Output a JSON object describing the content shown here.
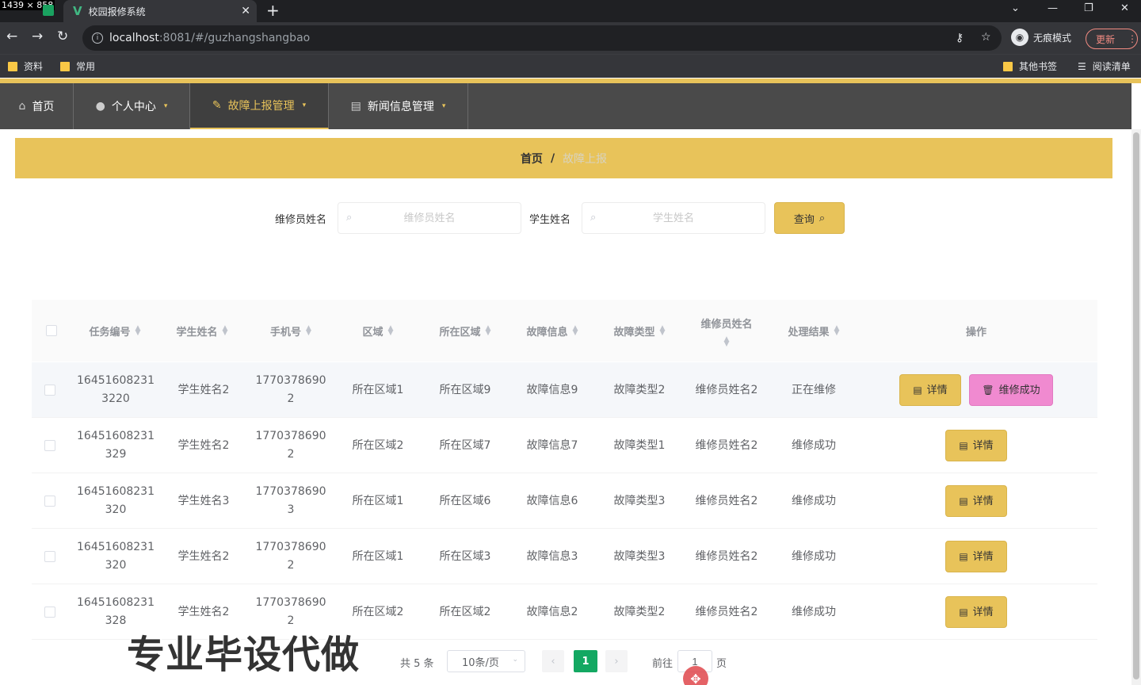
{
  "screen_dims": "1439 × 858",
  "browser": {
    "tab_title": "校园报修系统",
    "url_host": "localhost",
    "url_rest": ":8081/#/guzhangshangbao",
    "incognito_label": "无痕模式",
    "update_label": "更新",
    "bookmarks": [
      "资料",
      "常用"
    ],
    "bookmarks_right": [
      "其他书签",
      "阅读清单"
    ]
  },
  "nav": {
    "items": [
      {
        "label": "首页"
      },
      {
        "label": "个人中心"
      },
      {
        "label": "故障上报管理"
      },
      {
        "label": "新闻信息管理"
      }
    ]
  },
  "breadcrumb": {
    "home": "首页",
    "separator": "/",
    "current": "故障上报"
  },
  "search": {
    "repair_name_label": "维修员姓名",
    "repair_name_placeholder": "维修员姓名",
    "student_name_label": "学生姓名",
    "student_name_placeholder": "学生姓名",
    "query_label": "查询"
  },
  "table": {
    "headers": [
      "任务编号",
      "学生姓名",
      "手机号",
      "区域",
      "所在区域",
      "故障信息",
      "故障类型",
      "维修员姓名",
      "处理结果",
      "操作"
    ],
    "rows": [
      {
        "task_a": "16451608231",
        "task_b": "3220",
        "student": "学生姓名2",
        "phone_a": "1770378690",
        "phone_b": "2",
        "area": "所在区域1",
        "location": "所在区域9",
        "fault": "故障信息9",
        "type": "故障类型2",
        "repairman": "维修员姓名2",
        "result": "正在维修",
        "detail": "详情",
        "repair_btn": "维修成功"
      },
      {
        "task_a": "16451608231",
        "task_b": "329",
        "student": "学生姓名2",
        "phone_a": "1770378690",
        "phone_b": "2",
        "area": "所在区域2",
        "location": "所在区域7",
        "fault": "故障信息7",
        "type": "故障类型1",
        "repairman": "维修员姓名2",
        "result": "维修成功",
        "detail": "详情"
      },
      {
        "task_a": "16451608231",
        "task_b": "320",
        "student": "学生姓名3",
        "phone_a": "1770378690",
        "phone_b": "3",
        "area": "所在区域1",
        "location": "所在区域6",
        "fault": "故障信息6",
        "type": "故障类型3",
        "repairman": "维修员姓名2",
        "result": "维修成功",
        "detail": "详情"
      },
      {
        "task_a": "16451608231",
        "task_b": "320",
        "student": "学生姓名2",
        "phone_a": "1770378690",
        "phone_b": "2",
        "area": "所在区域1",
        "location": "所在区域3",
        "fault": "故障信息3",
        "type": "故障类型3",
        "repairman": "维修员姓名2",
        "result": "维修成功",
        "detail": "详情"
      },
      {
        "task_a": "16451608231",
        "task_b": "328",
        "student": "学生姓名2",
        "phone_a": "1770378690",
        "phone_b": "2",
        "area": "所在区域2",
        "location": "所在区域2",
        "fault": "故障信息2",
        "type": "故障类型2",
        "repairman": "维修员姓名2",
        "result": "维修成功",
        "detail": "详情"
      }
    ]
  },
  "pagination": {
    "total": "共 5 条",
    "page_size": "10条/页",
    "current_page": "1",
    "goto_label": "前往",
    "goto_value": "1",
    "page_suffix": "页"
  },
  "watermark": "专业毕设代做",
  "colors": {
    "accent": "#e8c35a",
    "nav_bg": "#4a4a4a",
    "repair_button": "#f08ad0",
    "pager_active": "#13a862"
  }
}
